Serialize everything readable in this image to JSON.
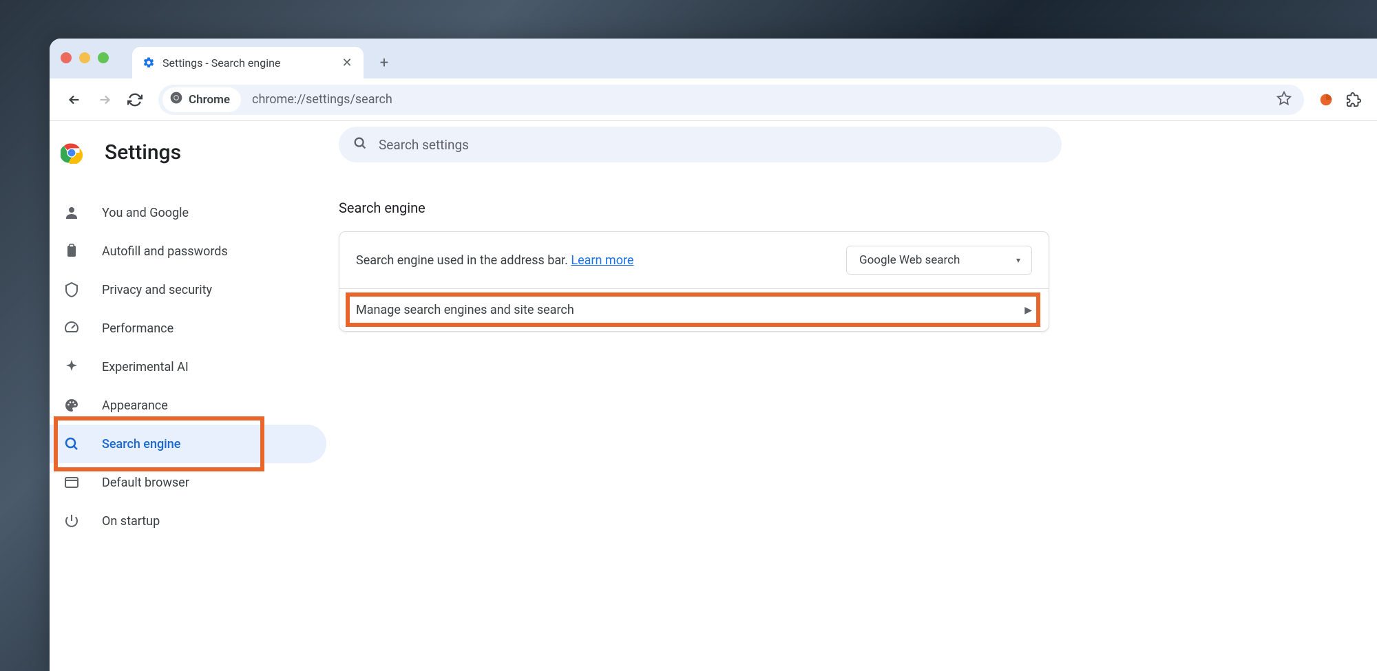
{
  "tab": {
    "title": "Settings - Search engine"
  },
  "addressbar": {
    "chip": "Chrome",
    "url": "chrome://settings/search"
  },
  "settings_header": "Settings",
  "search_placeholder": "Search settings",
  "sidebar": {
    "items": [
      {
        "label": "You and Google"
      },
      {
        "label": "Autofill and passwords"
      },
      {
        "label": "Privacy and security"
      },
      {
        "label": "Performance"
      },
      {
        "label": "Experimental AI"
      },
      {
        "label": "Appearance"
      },
      {
        "label": "Search engine"
      },
      {
        "label": "Default browser"
      },
      {
        "label": "On startup"
      }
    ]
  },
  "main": {
    "section_title": "Search engine",
    "row1_text": "Search engine used in the address bar. ",
    "row1_link": "Learn more",
    "dropdown_value": "Google Web search",
    "row2_text": "Manage search engines and site search"
  }
}
